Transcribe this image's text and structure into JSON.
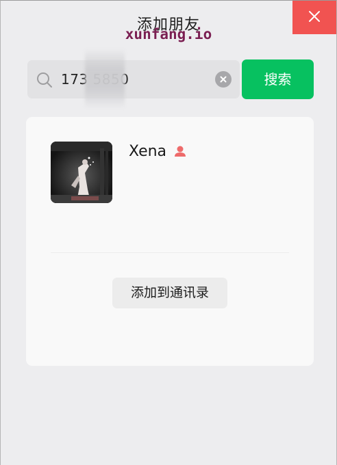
{
  "window": {
    "title": "添加朋友"
  },
  "watermark": "xunfang.io",
  "close": {
    "icon": "close-icon"
  },
  "search": {
    "value": "173     5850",
    "icon": "search-icon",
    "clear_icon": "clear-icon",
    "button_label": "搜索"
  },
  "result": {
    "name": "Xena",
    "gender_icon": "female-user-icon",
    "gender_color": "#ee6b6b",
    "add_button_label": "添加到通讯录"
  },
  "colors": {
    "accent": "#07c160",
    "close": "#f15351"
  }
}
